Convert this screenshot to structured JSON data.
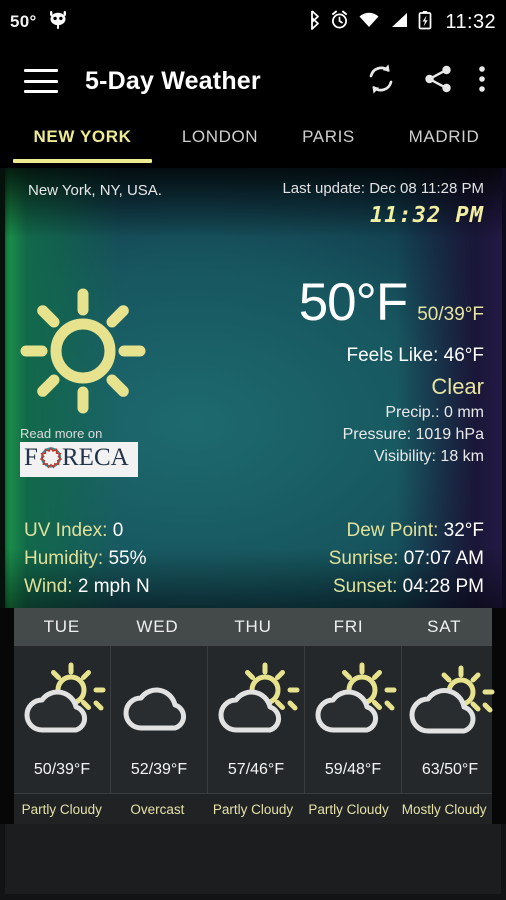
{
  "statusbar": {
    "temperature": "50°",
    "clock": "11:32",
    "icons": [
      "cyanogenmod-icon",
      "bluetooth-icon",
      "alarm-icon",
      "wifi-icon",
      "signal-icon",
      "battery-charging-icon"
    ]
  },
  "appbar": {
    "title": "5-Day Weather",
    "menu_icon": "hamburger-menu-icon",
    "refresh_icon": "refresh-icon",
    "share_icon": "share-icon",
    "overflow_icon": "overflow-menu-icon"
  },
  "tabs": [
    {
      "label": "NEW YORK",
      "active": true
    },
    {
      "label": "LONDON",
      "active": false
    },
    {
      "label": "PARIS",
      "active": false
    },
    {
      "label": "MADRID",
      "active": false
    }
  ],
  "current": {
    "location": "New York, NY, USA.",
    "last_update": "Last update: Dec 08  11:28 PM",
    "clock": "11:32 PM",
    "icon": "sun-icon",
    "temperature": "50°F",
    "high_low": "50/39°F",
    "feels_like": "Feels Like: 46°F",
    "condition": "Clear",
    "precipitation": "Precip.: 0 mm",
    "pressure": "Pressure: 1019 hPa",
    "visibility": "Visibility: 18 km"
  },
  "stats_left": [
    {
      "label": "UV Index:",
      "value": "0"
    },
    {
      "label": "Humidity:",
      "value": "55%"
    },
    {
      "label": "Wind:",
      "value": "2 mph N"
    }
  ],
  "stats_right": [
    {
      "label": "Dew Point:",
      "value": "32°F"
    },
    {
      "label": "Sunrise:",
      "value": "07:07 AM"
    },
    {
      "label": "Sunset:",
      "value": "04:28 PM"
    }
  ],
  "branding": {
    "read_more": "Read more on",
    "provider": "FORECA"
  },
  "forecast": {
    "days": [
      "TUE",
      "WED",
      "THU",
      "FRI",
      "SAT"
    ],
    "temps": [
      "50/39°F",
      "52/39°F",
      "57/46°F",
      "59/48°F",
      "63/50°F"
    ],
    "conditions": [
      "Partly Cloudy",
      "Overcast",
      "Partly Cloudy",
      "Partly Cloudy",
      "Mostly Cloudy"
    ],
    "icons": [
      "partly-cloudy-icon",
      "overcast-icon",
      "partly-cloudy-icon",
      "partly-cloudy-icon",
      "mostly-cloudy-icon"
    ]
  },
  "colors": {
    "accent_yellow": "#eeeb92",
    "text_white": "#ffffff",
    "sun_yellow": "#e6e28e",
    "cloud_gray": "#e4e4e4"
  }
}
